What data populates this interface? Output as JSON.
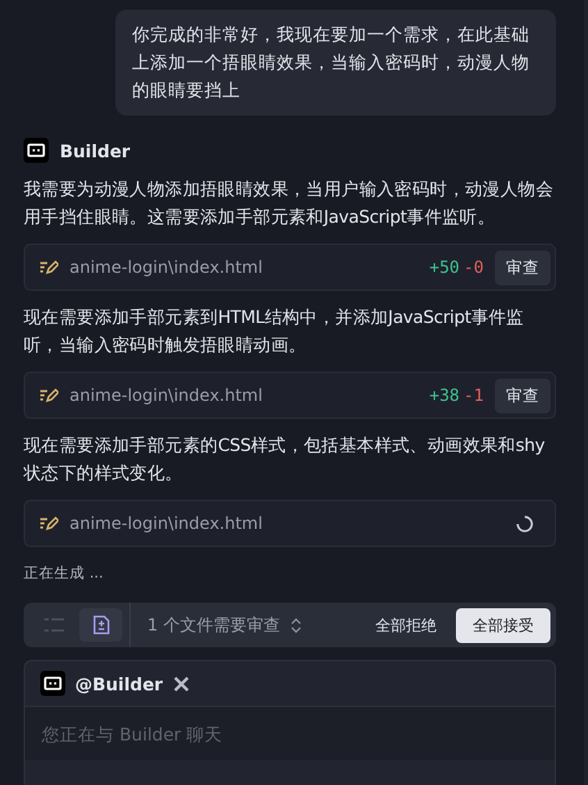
{
  "user_message": "你完成的非常好，我现在要加一个需求，在此基础上添加一个捂眼睛效果，当输入密码时，动漫人物的眼睛要挡上",
  "assistant": {
    "name": "Builder"
  },
  "blocks": [
    {
      "kind": "text",
      "text": "我需要为动漫人物添加捂眼睛效果，当用户输入密码时，动漫人物会用手挡住眼睛。这需要添加手部元素和JavaScript事件监听。"
    },
    {
      "kind": "file",
      "path": "anime-login\\index.html",
      "generating": false,
      "additions": "+50",
      "deletions": "-0",
      "button": "审查"
    },
    {
      "kind": "text",
      "text": "现在需要添加手部元素到HTML结构中，并添加JavaScript事件监听，当输入密码时触发捂眼睛动画。"
    },
    {
      "kind": "file",
      "path": "anime-login\\index.html",
      "generating": false,
      "additions": "+38",
      "deletions": "-1",
      "button": "审查"
    },
    {
      "kind": "text",
      "text": "现在需要添加手部元素的CSS样式，包括基本样式、动画效果和shy状态下的样式变化。"
    },
    {
      "kind": "file",
      "path": "anime-login\\index.html",
      "generating": true
    }
  ],
  "status": "正在生成 ...",
  "review_bar": {
    "summary": "1 个文件需要审查",
    "reject_all": "全部拒绝",
    "accept_all": "全部接受"
  },
  "composer": {
    "mention": "@Builder",
    "placeholder": "您正在与 Builder 聊天"
  }
}
